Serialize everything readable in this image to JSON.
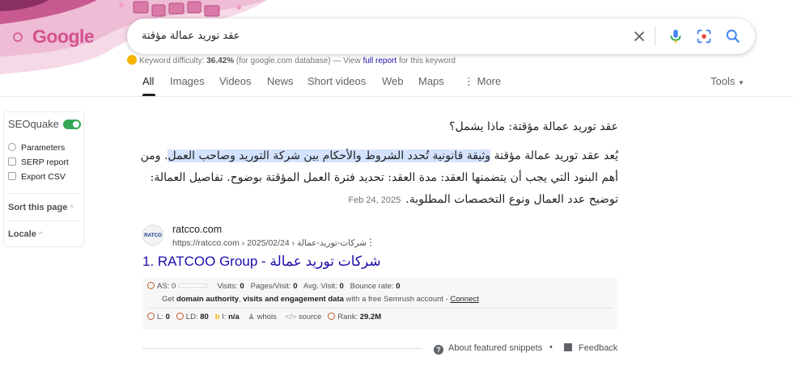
{
  "search": {
    "query": "عقد توريد عمالة مؤقتة",
    "logo_text": "Google"
  },
  "keyword_difficulty": {
    "label": "Keyword difficulty:",
    "value": "36.42%",
    "database": "(for google.com database) — View",
    "link": "full report",
    "suffix": "for this keyword"
  },
  "tabs": [
    "All",
    "Images",
    "Videos",
    "News",
    "Short videos",
    "Web",
    "Maps",
    "More"
  ],
  "tools_label": "Tools",
  "seoquake": {
    "title": "SEOquake",
    "items": [
      "Parameters",
      "SERP report",
      "Export CSV"
    ],
    "sections": [
      "Sort this page",
      "Locale"
    ]
  },
  "snippet": {
    "title": "عقد توريد عمالة مؤقتة: ماذا يشمل؟",
    "line1_pre": "يُعد عقد توريد عمالة مؤقتة ",
    "line1_hl": "وثيقة قانونية تُحدد الشروط والأحكام بين شركة التوريد وصاحب العمل",
    "line1_post": ". ومن",
    "line2": "أهم البنود التي يجب أن يتضمنها العقد: مدة العقد: تحديد فترة العمل المؤقتة بوضوح. تفاصيل العمالة:",
    "line3": "توضيح عدد العمال ونوع التخصصات المطلوبة.",
    "date": "Feb 24, 2025"
  },
  "result": {
    "favicon_text": "RATCO",
    "site_name": "ratcco.com",
    "url": "https://ratcco.com › 2025/02/24 › شركات-توريد-عمالة",
    "title": "1. RATCOO Group - شركات توريد عمالة"
  },
  "seo_metrics": {
    "row1": {
      "as": "AS: 0",
      "visits_label": "Visits:",
      "visits": "0",
      "pages_label": "Pages/Visit:",
      "pages": "0",
      "avg_label": "Avg. Visit:",
      "avg": "0",
      "bounce_label": "Bounce rate:",
      "bounce": "0"
    },
    "row2": {
      "pre": "Get",
      "b1": "domain authority",
      "mid": ",",
      "b2": "visits and engagement data",
      "post": "with a free Semrush account -",
      "link": "Connect"
    },
    "row3": {
      "l_label": "L:",
      "l": "0",
      "ld_label": "LD:",
      "ld": "80",
      "i_label": "I:",
      "i": "n/a",
      "whois": "whois",
      "source": "source",
      "rank_label": "Rank:",
      "rank": "29.2M"
    }
  },
  "footer": {
    "about": "About featured snippets",
    "dot": "•",
    "feedback": "Feedback"
  }
}
